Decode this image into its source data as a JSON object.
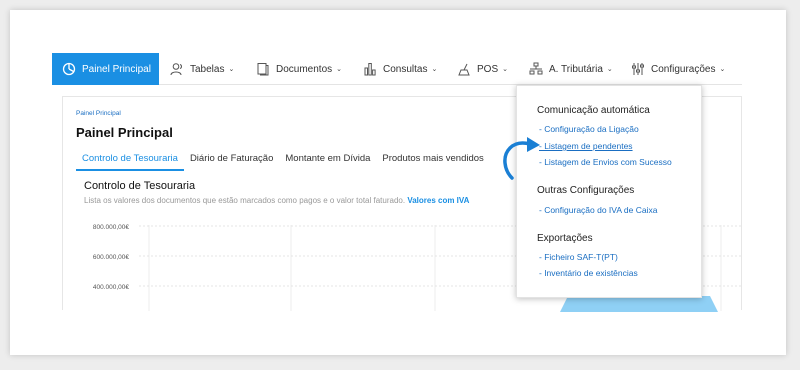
{
  "nav": {
    "items": [
      {
        "label": "Painel Principal",
        "icon": "pie-chart-icon",
        "active": true
      },
      {
        "label": "Tabelas",
        "icon": "users-icon"
      },
      {
        "label": "Documentos",
        "icon": "documents-icon"
      },
      {
        "label": "Consultas",
        "icon": "bar-chart-icon"
      },
      {
        "label": "POS",
        "icon": "pos-icon"
      },
      {
        "label": "A. Tributária",
        "icon": "network-icon"
      },
      {
        "label": "Configurações",
        "icon": "sliders-icon"
      }
    ]
  },
  "page": {
    "breadcrumb": "Painel Principal",
    "title": "Painel Principal",
    "tabs": [
      {
        "label": "Controlo de Tesouraria",
        "active": true
      },
      {
        "label": "Diário de Faturação"
      },
      {
        "label": "Montante em Dívida"
      },
      {
        "label": "Produtos mais vendidos"
      }
    ],
    "section_title": "Controlo de Tesouraria",
    "section_desc": "Lista os valores dos documentos que estão marcados como pagos e o valor total faturado.",
    "section_link": "Valores com IVA"
  },
  "chart_data": {
    "type": "bar",
    "y_tick_labels": [
      "800.000,00€",
      "600.000,00€",
      "400.000,00€"
    ],
    "grid": true
  },
  "dropdown": {
    "groups": [
      {
        "heading": "Comunicação automática",
        "items": [
          "- Configuração da Ligação",
          "- Listagem de pendentes",
          "- Listagem de Envios com Sucesso"
        ]
      },
      {
        "heading": "Outras Configurações",
        "items": [
          "- Configuração do IVA de Caixa"
        ]
      },
      {
        "heading": "Exportações",
        "items": [
          "- Ficheiro SAF-T(PT)",
          "- Inventário de existências"
        ]
      }
    ]
  },
  "colors": {
    "accent": "#1a8fe3",
    "link": "#1a6ec2",
    "chart_shape": "#8fd0f5"
  }
}
